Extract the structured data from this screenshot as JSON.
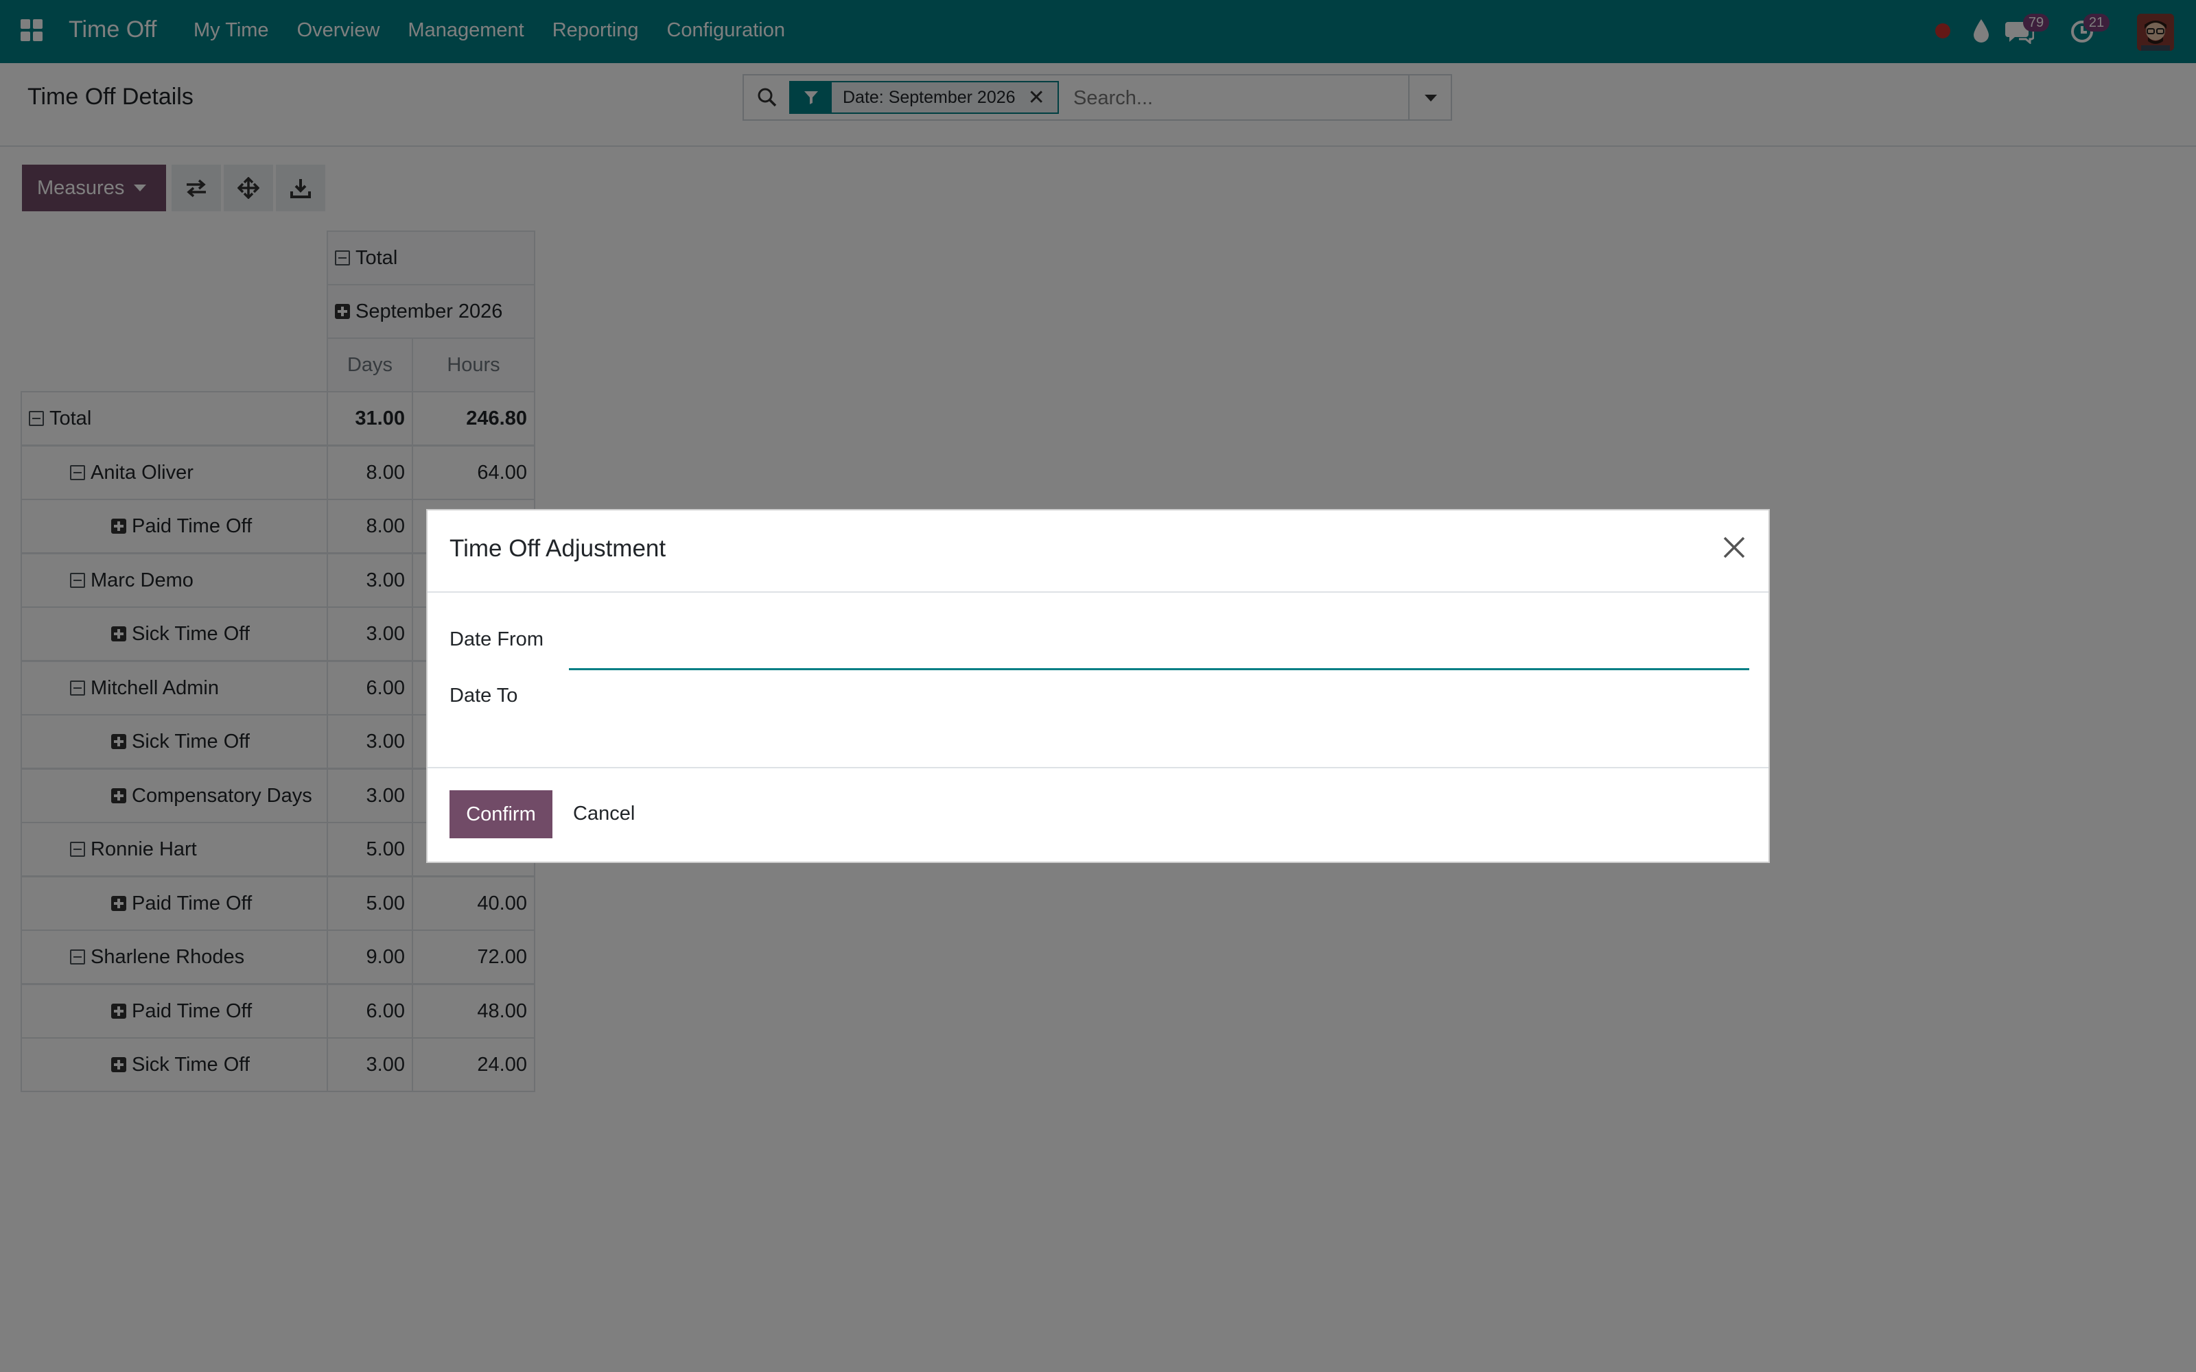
{
  "navbar": {
    "app_name": "Time Off",
    "menu": [
      "My Time",
      "Overview",
      "Management",
      "Reporting",
      "Configuration"
    ],
    "messages_count": "79",
    "activities_count": "21",
    "color": "#017e84"
  },
  "control_panel": {
    "title": "Time Off Details",
    "facet_label": "Date: September 2026",
    "search_placeholder": "Search..."
  },
  "toolbar": {
    "measures_label": "Measures"
  },
  "pivot": {
    "col_total": "Total",
    "col_period": "September 2026",
    "measure_headers": [
      "Days",
      "Hours"
    ],
    "rows": [
      {
        "label": "Total",
        "level": 0,
        "toggle": "minus",
        "days": "31.00",
        "hours": "246.80",
        "bold": true
      },
      {
        "label": "Anita Oliver",
        "level": 1,
        "toggle": "minus",
        "days": "8.00",
        "hours": "64.00"
      },
      {
        "label": "Paid Time Off",
        "level": 2,
        "toggle": "plus",
        "days": "8.00",
        "hours": ""
      },
      {
        "label": "Marc Demo",
        "level": 1,
        "toggle": "minus",
        "days": "3.00",
        "hours": ""
      },
      {
        "label": "Sick Time Off",
        "level": 2,
        "toggle": "plus",
        "days": "3.00",
        "hours": ""
      },
      {
        "label": "Mitchell Admin",
        "level": 1,
        "toggle": "minus",
        "days": "6.00",
        "hours": ""
      },
      {
        "label": "Sick Time Off",
        "level": 2,
        "toggle": "plus",
        "days": "3.00",
        "hours": ""
      },
      {
        "label": "Compensatory Days",
        "level": 2,
        "toggle": "plus",
        "days": "3.00",
        "hours": ""
      },
      {
        "label": "Ronnie Hart",
        "level": 1,
        "toggle": "minus",
        "days": "5.00",
        "hours": ""
      },
      {
        "label": "Paid Time Off",
        "level": 2,
        "toggle": "plus",
        "days": "5.00",
        "hours": "40.00"
      },
      {
        "label": "Sharlene Rhodes",
        "level": 1,
        "toggle": "minus",
        "days": "9.00",
        "hours": "72.00"
      },
      {
        "label": "Paid Time Off",
        "level": 2,
        "toggle": "plus",
        "days": "6.00",
        "hours": "48.00"
      },
      {
        "label": "Sick Time Off",
        "level": 2,
        "toggle": "plus",
        "days": "3.00",
        "hours": "24.00"
      }
    ]
  },
  "modal": {
    "title": "Time Off Adjustment",
    "date_from_label": "Date From",
    "date_to_label": "Date To",
    "date_from_value": "",
    "date_to_value": "",
    "confirm_label": "Confirm",
    "cancel_label": "Cancel"
  }
}
